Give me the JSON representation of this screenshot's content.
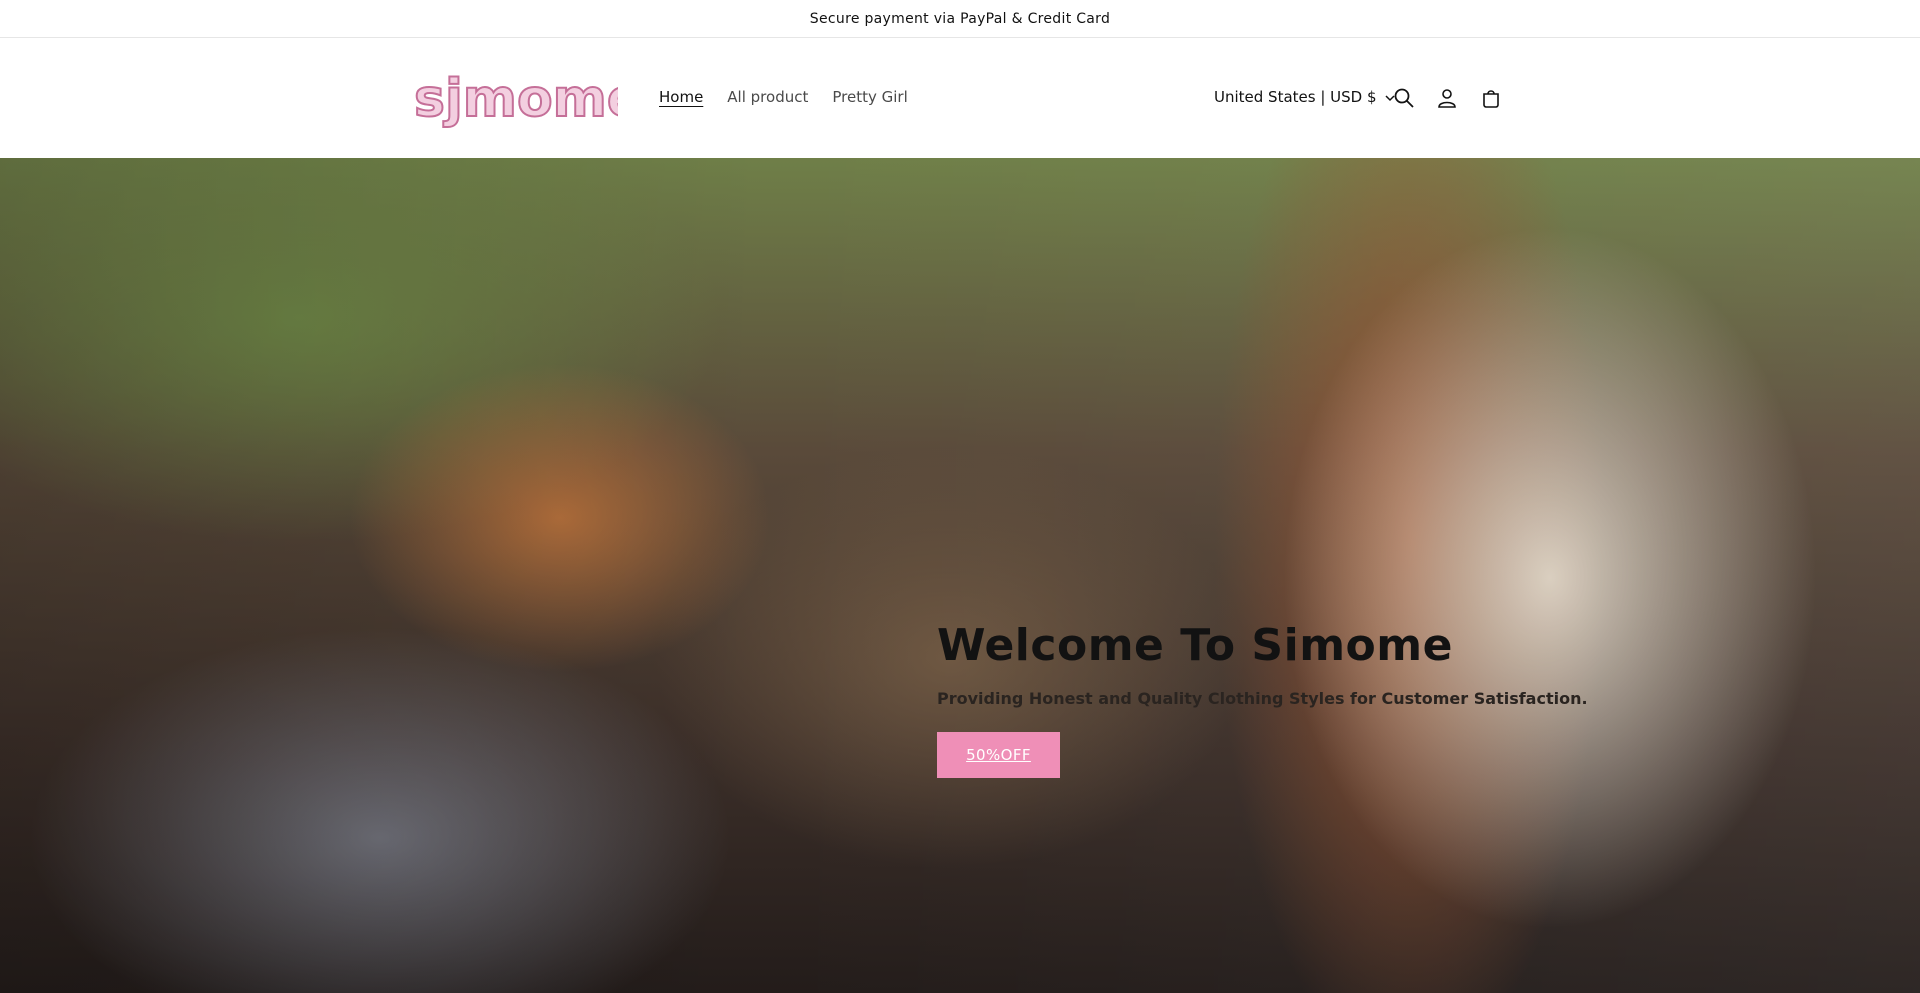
{
  "announcement": {
    "text": "Secure payment via PayPal & Credit Card"
  },
  "header": {
    "logo_text": "sjmome",
    "nav": [
      {
        "label": "Home",
        "active": true
      },
      {
        "label": "All product",
        "active": false
      },
      {
        "label": "Pretty Girl",
        "active": false
      }
    ],
    "localization": "United States | USD $",
    "icons": [
      "search-icon",
      "account-icon",
      "cart-icon",
      "chevron-down-icon"
    ]
  },
  "hero": {
    "title": "Welcome To Simome",
    "subtitle": "Providing Honest and Quality Clothing Styles for Customer Satisfaction.",
    "button_label": "50%OFF",
    "button_color": "#ef8fb7"
  }
}
